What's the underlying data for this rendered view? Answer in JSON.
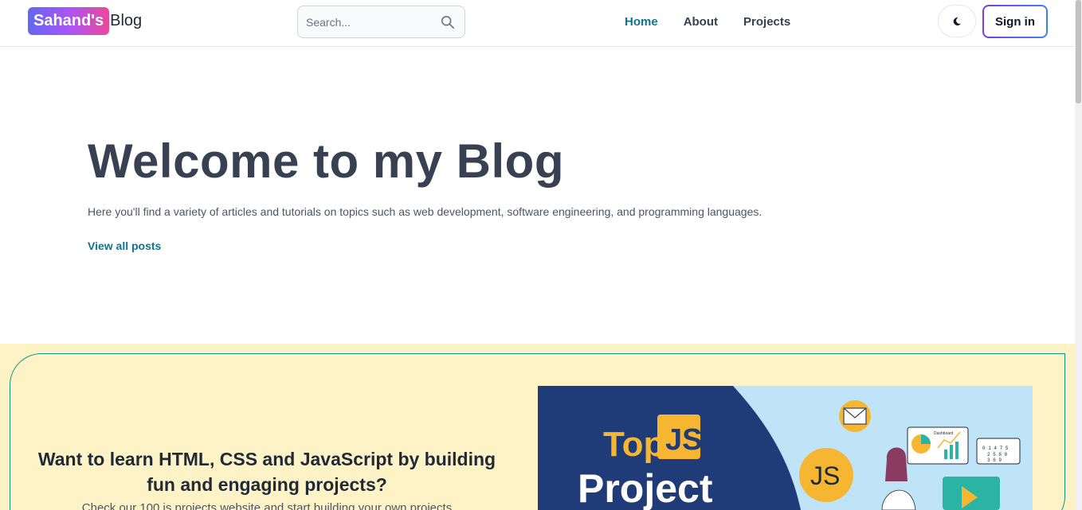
{
  "header": {
    "logo_badge": "Sahand's",
    "logo_text": "Blog",
    "search_placeholder": "Search...",
    "nav": [
      {
        "label": "Home",
        "active": true
      },
      {
        "label": "About",
        "active": false
      },
      {
        "label": "Projects",
        "active": false
      }
    ],
    "theme_icon": "moon-icon",
    "signin_label": "Sign in"
  },
  "hero": {
    "title": "Welcome to my Blog",
    "subtitle": "Here you'll find a variety of articles and tutorials on topics such as web development, software engineering, and programming languages.",
    "link": "View all posts"
  },
  "cta": {
    "heading": "Want to learn HTML, CSS and JavaScript by building fun and engaging projects?",
    "text": "Check our 100 js projects website and start building your own projects",
    "image": {
      "title_top": "Top",
      "title_js": "JS",
      "title_project": "Project",
      "bubble_js": "JS",
      "dashboard_label": "Dashboard",
      "calc_numbers": [
        "0 1 4 7 5",
        "2 5 8 0",
        "3 6 9"
      ]
    }
  },
  "colors": {
    "accent": "#0e7490",
    "cta_bg": "#fef3c7",
    "cta_border": "#0d9488",
    "image_dark": "#1f3b78",
    "image_yellow": "#f6b631"
  }
}
